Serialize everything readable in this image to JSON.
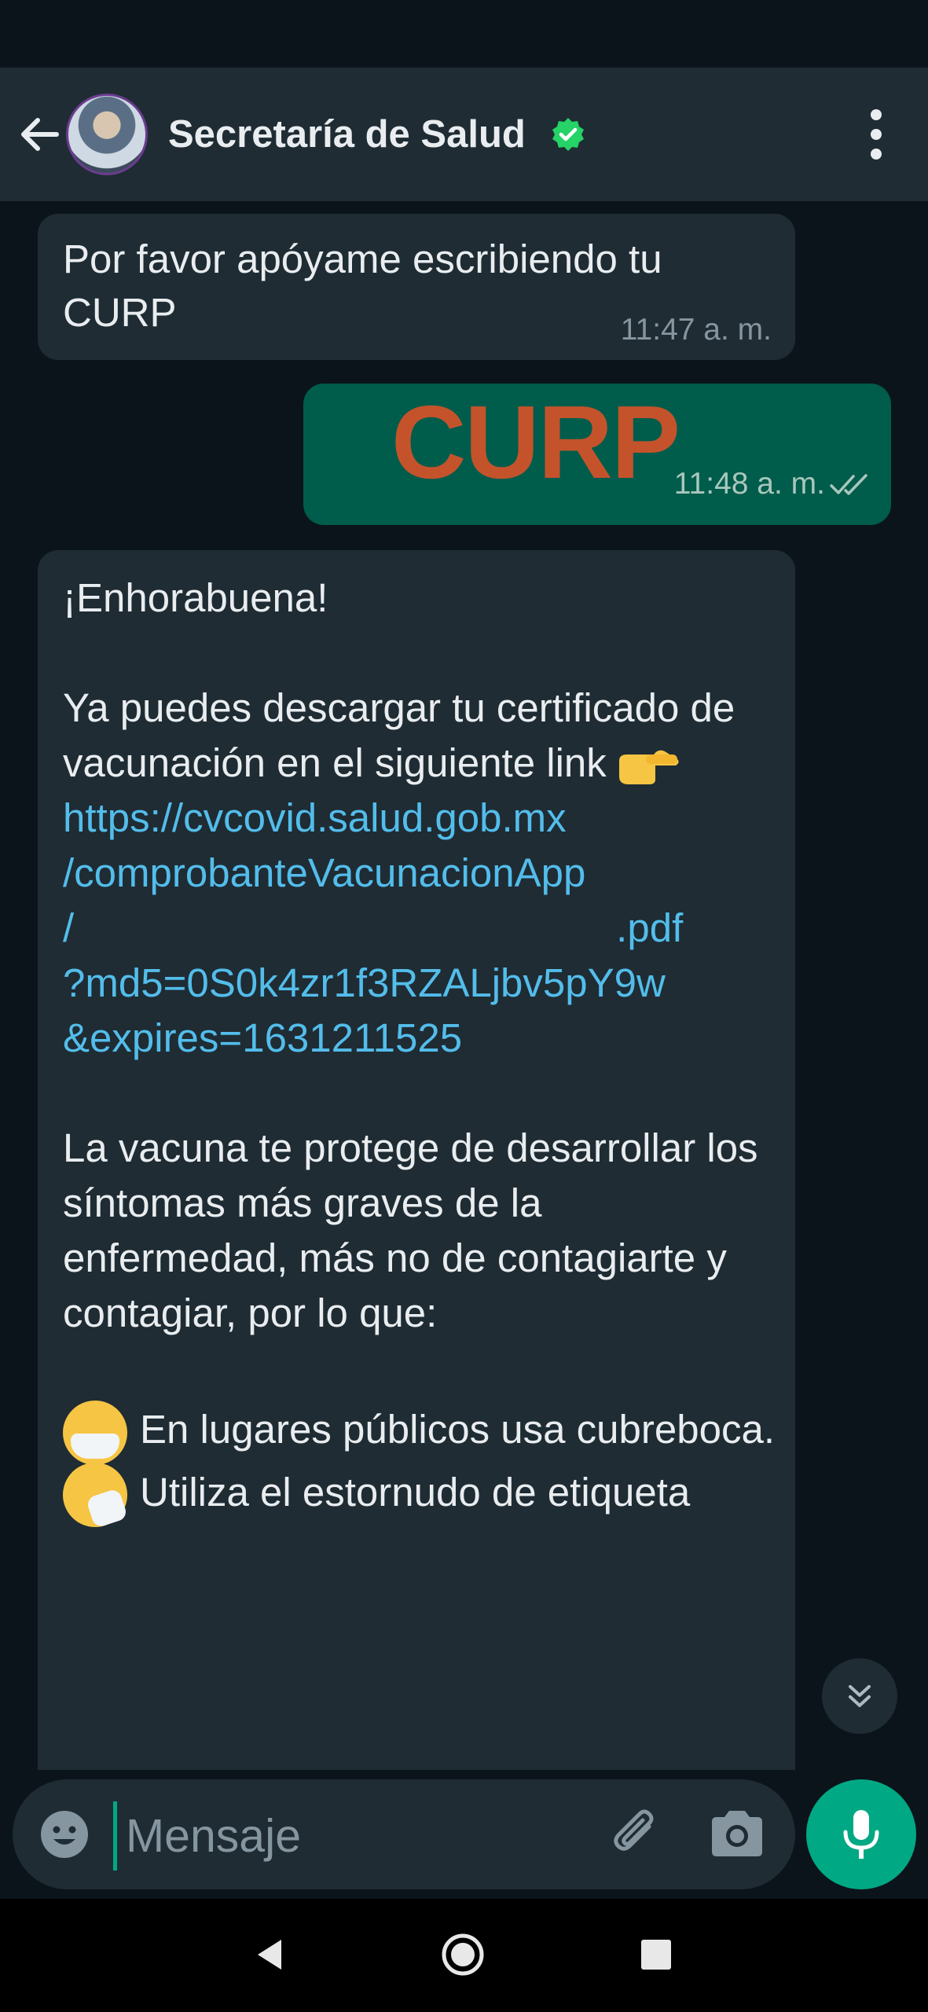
{
  "header": {
    "title": "Secretaría de Salud"
  },
  "messages": {
    "m1": {
      "text": "Por favor apóyame escribiendo tu CURP",
      "time": "11:47 a. m."
    },
    "m2": {
      "text": "CURP",
      "time": "11:48 a. m."
    },
    "m3": {
      "greeting": "¡Enhorabuena!",
      "intro": "Ya puedes descargar tu certificado de vacunación en el siguiente link",
      "link_line1": "https://cvcovid.salud.gob.mx",
      "link_line2": "/comprobanteVacunacionApp",
      "link_line3_start": "/",
      "link_line3_end": ".pdf",
      "link_line4": "?md5=0S0k4zr1f3RZALjbv5pY9w",
      "link_line5": "&expires=1631211525",
      "para": "La vacuna te protege de desarrollar los síntomas más graves de la enfermedad, más no de contagiarte y contagiar, por lo que:",
      "tip1": "En lugares públicos usa cubreboca.",
      "tip2": "Utiliza el estornudo de etiqueta"
    }
  },
  "composer": {
    "placeholder": "Mensaje"
  },
  "icons": {
    "back": "arrow-left-icon",
    "verified": "verified-check-icon",
    "menu": "more-vertical-icon",
    "emoji": "emoji-icon",
    "attach": "paperclip-icon",
    "camera": "camera-icon",
    "mic": "microphone-icon",
    "scroll": "double-chevron-down-icon"
  },
  "colors": {
    "background": "#0b141a",
    "header": "#1f2c34",
    "incoming_bubble": "#1f2c34",
    "outgoing_bubble": "#005c4b",
    "link": "#53bdeb",
    "accent": "#00a884",
    "curp_text": "#c4532b"
  }
}
